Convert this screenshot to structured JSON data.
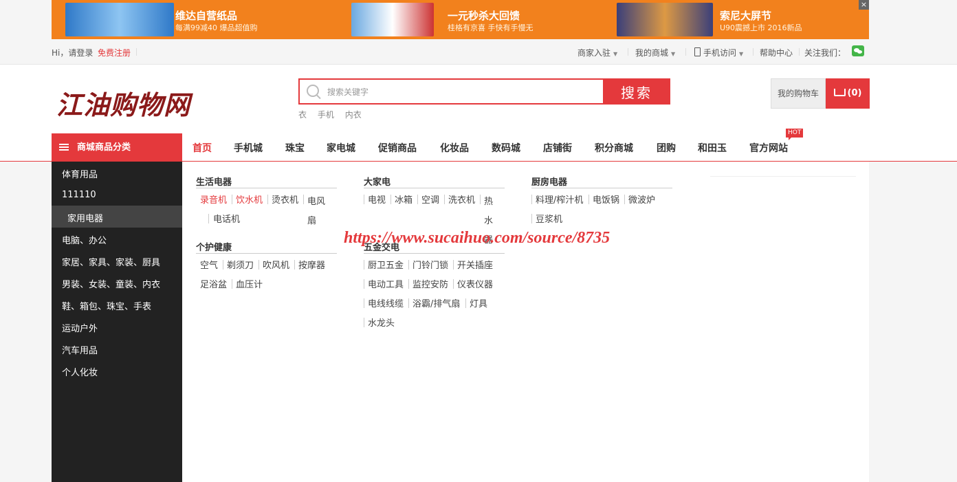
{
  "banner": {
    "promos": [
      {
        "title": "维达自营纸品",
        "subtitle": "每满99减40  爆品超值购",
        "color": "#2f79c8"
      },
      {
        "title": "一元秒杀大回馈",
        "subtitle": "桂格有京喜  手快有手慢无",
        "color": "#6aa8e0"
      },
      {
        "title": "索尼大屏节",
        "subtitle": "U90震撼上市  2016新品",
        "color": "#3a3f7a"
      }
    ],
    "close": "×"
  },
  "topbar": {
    "greeting": "Hi，请登录",
    "register": "免费注册",
    "merchant": "商家入驻",
    "my_mall": "我的商城",
    "mobile": "手机访问",
    "help": "帮助中心",
    "follow": "关注我们："
  },
  "header": {
    "logo": "江油购物网",
    "search_placeholder": "搜索关键字",
    "search_button": "搜索",
    "hot_words": [
      "衣",
      "手机",
      "内衣"
    ],
    "cart_label": "我的购物车",
    "cart_count": "(0)"
  },
  "nav": {
    "category_header": "商城商品分类",
    "items": [
      "首页",
      "手机城",
      "珠宝",
      "家电城",
      "促销商品",
      "化妆品",
      "数码城",
      "店铺街",
      "积分商城",
      "团购",
      "和田玉",
      "官方网站"
    ],
    "hot_badge": "HOT"
  },
  "sidebar": {
    "items": [
      "体育用品",
      "111110",
      "家用电器",
      "电脑、办公",
      "家居、家具、家装、厨具",
      "男装、女装、童装、内衣",
      "鞋、箱包、珠宝、手表",
      "运动户外",
      "汽车用品",
      "个人化妆"
    ]
  },
  "panel": {
    "groups": [
      {
        "title": "生活电器",
        "items": [
          "录音机",
          "饮水机",
          "烫衣机",
          "电风扇",
          "电话机"
        ]
      },
      {
        "title": "个护健康",
        "items": [
          "空气",
          "剃须刀",
          "吹风机",
          "按摩器",
          "足浴盆",
          "血压计"
        ]
      },
      {
        "title": "大家电",
        "items": [
          "电视",
          "冰箱",
          "空调",
          "洗衣机",
          "热水器"
        ]
      },
      {
        "title": "五金交电",
        "items": [
          "厨卫五金",
          "门铃门锁",
          "开关插座",
          "电动工具",
          "监控安防",
          "仪表仪器",
          "电线线缆",
          "浴霸/排气扇",
          "灯具",
          "水龙头"
        ]
      },
      {
        "title": "厨房电器",
        "items": [
          "料理/榨汁机",
          "电饭锅",
          "微波炉",
          "豆浆机"
        ]
      }
    ]
  },
  "watermark": "https://www.sucaihuo.com/source/8735",
  "colors": {
    "accent": "#e4393c",
    "sidebar": "#222222",
    "banner": "#f2811d"
  }
}
